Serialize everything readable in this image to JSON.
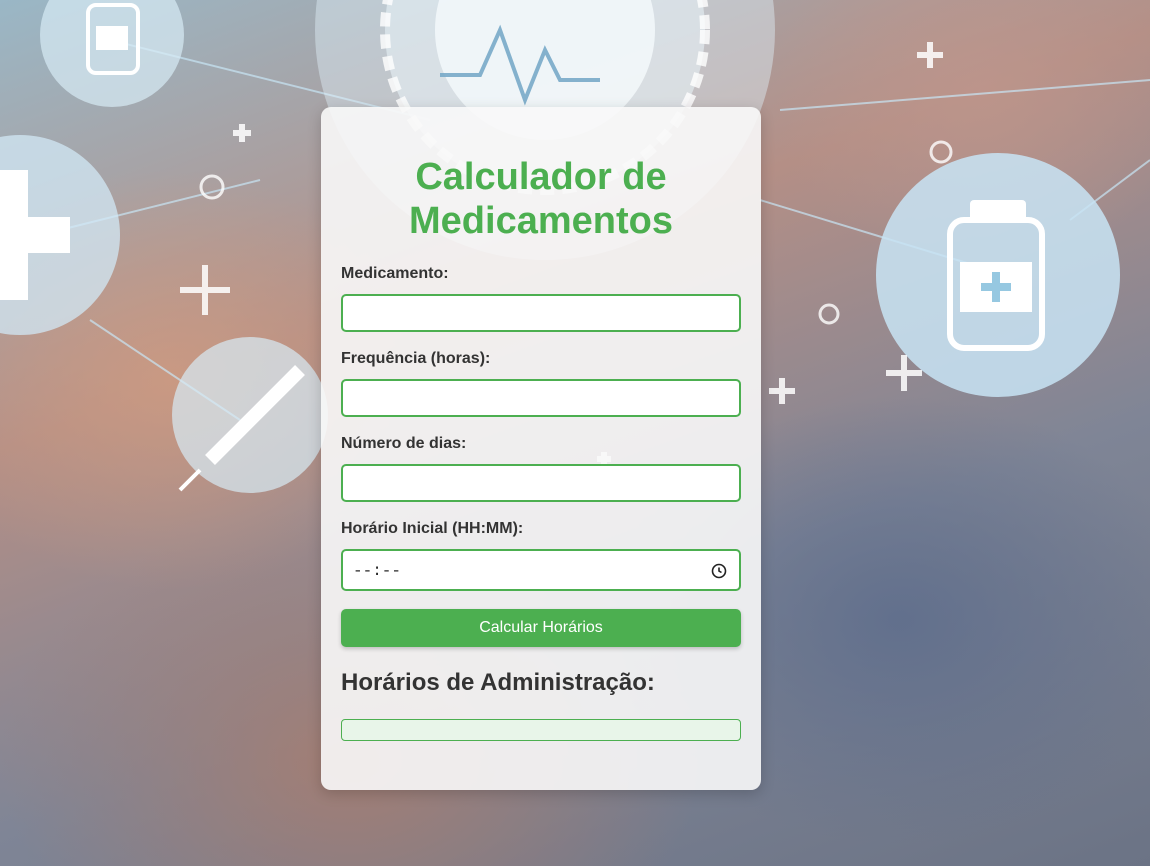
{
  "colors": {
    "accent": "#4caf50",
    "result_background": "#e8f5e9",
    "label_text": "#333333"
  },
  "background": {
    "icons": [
      "medicine-bottle-icon",
      "plus-icon",
      "syringe-icon",
      "heartbeat-icon"
    ]
  },
  "form": {
    "title": "Calculador de Medicamentos",
    "fields": [
      {
        "label": "Medicamento:",
        "value": ""
      },
      {
        "label": "Frequência (horas):",
        "value": ""
      },
      {
        "label": "Número de dias:",
        "value": ""
      },
      {
        "label": "Horário Inicial (HH:MM):",
        "value": "--:--",
        "icon": "clock-icon"
      }
    ],
    "submit_label": "Calcular Horários"
  },
  "results": {
    "title": "Horários de Administração:",
    "items": []
  }
}
